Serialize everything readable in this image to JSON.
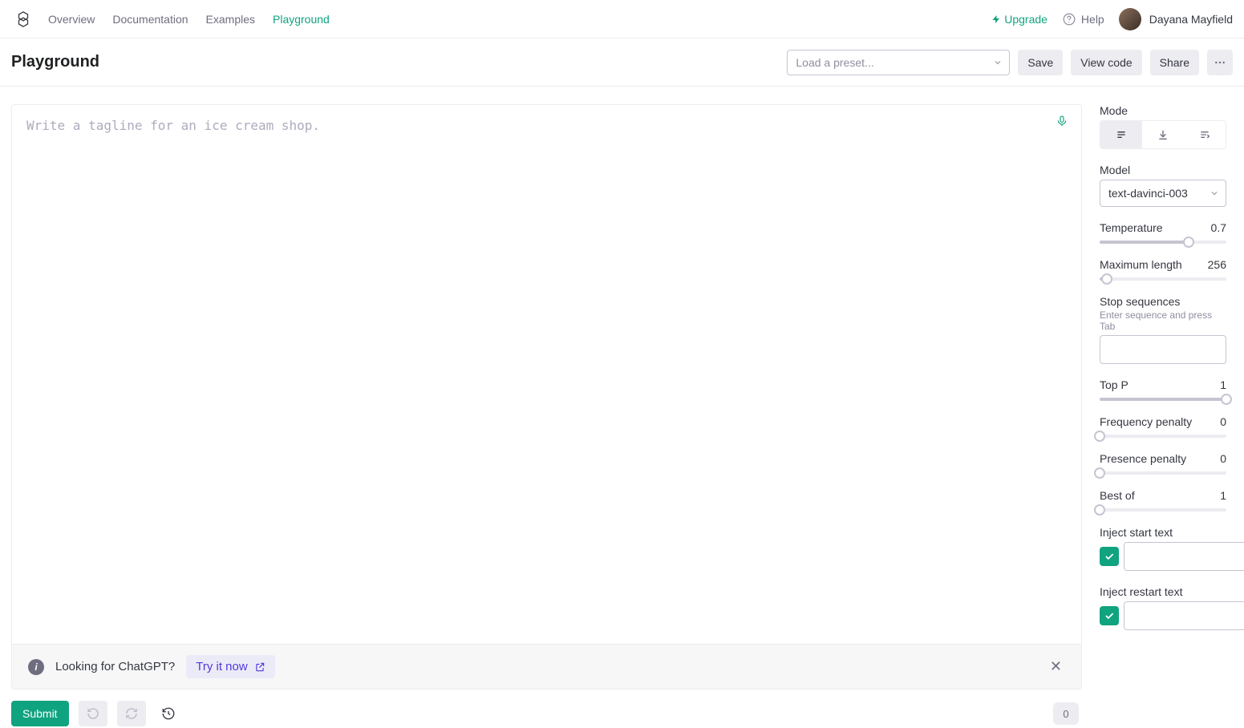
{
  "nav": {
    "links": [
      "Overview",
      "Documentation",
      "Examples",
      "Playground"
    ],
    "active_index": 3,
    "upgrade_label": "Upgrade",
    "help_label": "Help",
    "user_name": "Dayana Mayfield"
  },
  "header": {
    "title": "Playground",
    "preset_placeholder": "Load a preset...",
    "save_label": "Save",
    "view_code_label": "View code",
    "share_label": "Share"
  },
  "editor": {
    "placeholder": "Write a tagline for an ice cream shop.",
    "value": ""
  },
  "banner": {
    "text": "Looking for ChatGPT?",
    "try_label": "Try it now"
  },
  "footer": {
    "submit_label": "Submit",
    "token_count": "0"
  },
  "settings": {
    "mode_label": "Mode",
    "model_label": "Model",
    "model_value": "text-davinci-003",
    "temperature_label": "Temperature",
    "temperature_value": "0.7",
    "temperature_percent": 70,
    "max_length_label": "Maximum length",
    "max_length_value": "256",
    "max_length_percent": 6,
    "stop_label": "Stop sequences",
    "stop_sublabel": "Enter sequence and press Tab",
    "top_p_label": "Top P",
    "top_p_value": "1",
    "top_p_percent": 100,
    "freq_label": "Frequency penalty",
    "freq_value": "0",
    "freq_percent": 0,
    "pres_label": "Presence penalty",
    "pres_value": "0",
    "pres_percent": 0,
    "bestof_label": "Best of",
    "bestof_value": "1",
    "bestof_percent": 0,
    "inject_start_label": "Inject start text",
    "inject_restart_label": "Inject restart text"
  }
}
